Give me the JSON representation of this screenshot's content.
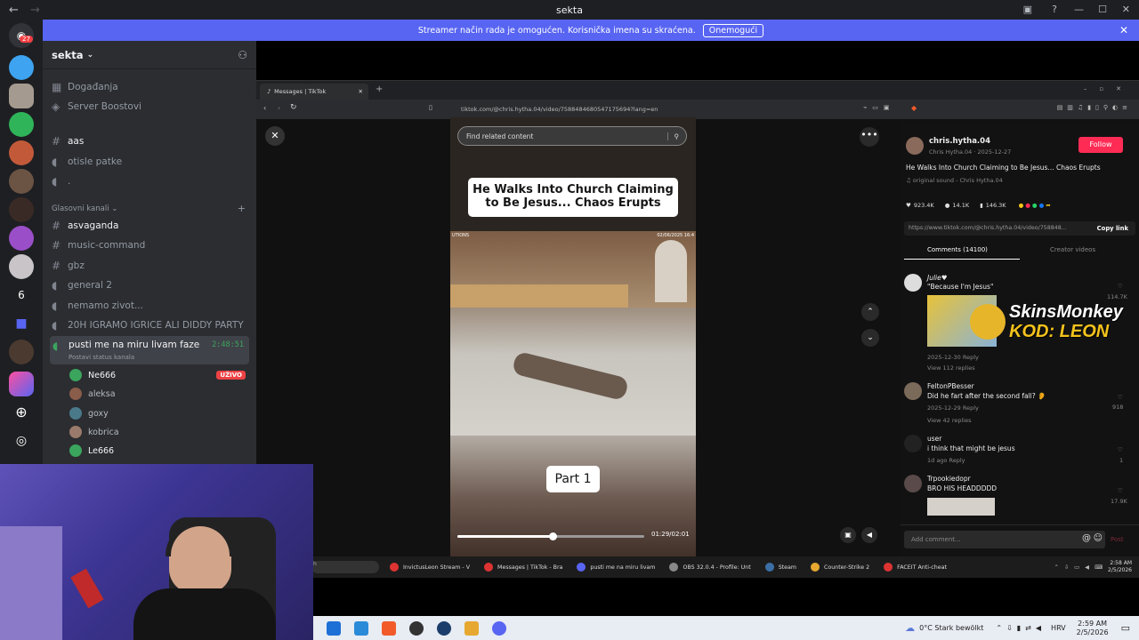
{
  "window": {
    "title": "sekta"
  },
  "banner": {
    "text": "Streamer način rada je omogućen. Korisnička imena su skraćena.",
    "button": "Onemogući"
  },
  "rail": {
    "badge": "27",
    "number_item": "6"
  },
  "sidebar": {
    "server_name": "sekta",
    "items": [
      {
        "icon": "calendar-icon",
        "label": "Događanja"
      },
      {
        "icon": "boost-icon",
        "label": "Server Boostovi"
      }
    ],
    "channels": [
      {
        "type": "text",
        "label": "aas",
        "bright": true
      },
      {
        "type": "voice",
        "label": "otisle patke",
        "bright": false
      },
      {
        "type": "voice",
        "label": ".",
        "bright": false
      }
    ],
    "category": "Glasovni kanali",
    "voice_channels": [
      {
        "type": "text",
        "label": "asvaganda",
        "bright": true
      },
      {
        "type": "text",
        "label": "music-command",
        "bright": false
      },
      {
        "type": "text",
        "label": "gbz",
        "bright": false
      },
      {
        "type": "voice",
        "label": "general 2",
        "bright": false
      },
      {
        "type": "voice",
        "label": "nemamo zivot...",
        "bright": false
      },
      {
        "type": "voice",
        "label": "20H IGRAMO IGRICE ALI DIDDY PARTY",
        "bright": false
      }
    ],
    "active_channel": {
      "label": "pusti me na miru livam faze",
      "timer": "2:48:51",
      "status": "Postavi status kanala"
    },
    "voice_users": [
      {
        "name": "Ne666",
        "live": "UŽIVO",
        "color": "#3ba55d"
      },
      {
        "name": "aleksa",
        "live": "",
        "color": "#8a5c4a"
      },
      {
        "name": "goxy",
        "live": "",
        "color": "#4a7a8a"
      },
      {
        "name": "kobrica",
        "live": "",
        "color": "#9a7a6a"
      },
      {
        "name": "Le666",
        "live": "",
        "color": "#3ba55d"
      }
    ]
  },
  "browser": {
    "tab_title": "Messages | TikTok",
    "url": "tiktok.com/@chris.hytha.04/video/7588484680547175694?lang=en",
    "search_placeholder": "Find related content",
    "video_headline": "He Walks Into Church Claiming to Be Jesus... Chaos Erupts",
    "video_part": "Part 1",
    "video_stamp_left": "UTIONS",
    "video_stamp_right": "02/06/2025 16:4",
    "video_time": "01:29/02:01",
    "video_progress": 0.51
  },
  "panel": {
    "author": "chris.hytha.04",
    "author_sub": "Chris Hytha.04 · 2025-12-27",
    "follow": "Follow",
    "caption": "He Walks Into Church Claiming to Be Jesus... Chaos Erupts",
    "sound": "original sound - Chris Hytha.04",
    "likes": "923.4K",
    "comments_count": "14.1K",
    "saves": "146.3K",
    "link": "https://www.tiktok.com/@chris.hytha.04/video/758848...",
    "copy_link": "Copy link",
    "tab_comments": "Comments (14100)",
    "tab_creator": "Creator videos",
    "comment_list": [
      {
        "user": "Julie♥",
        "text": "\"Because I'm Jesus\"",
        "meta": "2025-12-30   Reply",
        "replies": "View 112 replies",
        "likes": "114.7K"
      },
      {
        "user": "FeltonPBesser",
        "text": "Did he fart after the second fall? 👂",
        "meta": "2025-12-29   Reply",
        "replies": "View 42 replies",
        "likes": "918"
      },
      {
        "user": "user",
        "text": "i think that might be jesus",
        "meta": "1d ago   Reply",
        "replies": "",
        "likes": "1"
      },
      {
        "user": "Trpookiedopr",
        "text": "BRO HIS HEADDDDD",
        "meta": "",
        "replies": "",
        "likes": "17.9K"
      }
    ],
    "add_comment": "Add comment...",
    "post": "Post"
  },
  "inner_taskbar": [
    {
      "label": "InvictusLeon Stream - V",
      "color": "#d33"
    },
    {
      "label": "Messages | TikTok - Bra",
      "color": "#d33"
    },
    {
      "label": "pusti me na miru livam",
      "color": "#5865f2"
    },
    {
      "label": "OBS 32.0.4 - Profile: Unt",
      "color": "#888"
    },
    {
      "label": "Steam",
      "color": "#3a6ea5"
    },
    {
      "label": "Counter-Strike 2",
      "color": "#e6a830"
    },
    {
      "label": "FACEIT Anti-cheat",
      "color": "#d33"
    }
  ],
  "inner_clock": {
    "time": "2:58 AM",
    "date": "2/5/2026"
  },
  "sponsor": {
    "brand": "SkinsMonkey",
    "code": "KOD: LEON"
  },
  "windows_tray": {
    "weather": "0°C  Stark bewölkt",
    "lang": "HRV",
    "time": "2:59 AM",
    "date": "2/5/2026"
  }
}
